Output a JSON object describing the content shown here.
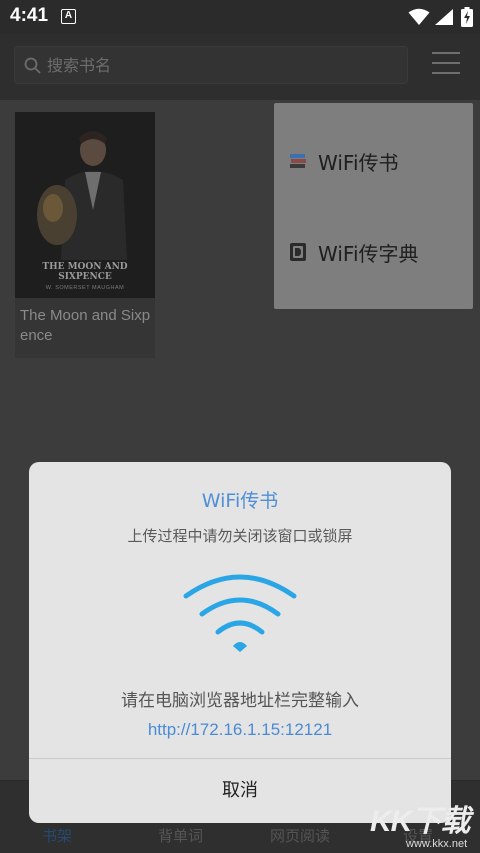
{
  "status_bar": {
    "time": "4:41",
    "notification_badge": "A",
    "icons": [
      "wifi-icon",
      "signal-icon",
      "battery-charging-icon"
    ]
  },
  "search": {
    "placeholder": "搜索书名",
    "icon": "search-icon"
  },
  "header": {
    "menu_icon": "menu-icon"
  },
  "bookshelf": {
    "books": [
      {
        "cover_title": "THE MOON AND SIXPENCE",
        "cover_author": "W. SOMERSET MAUGHAM",
        "title": "The Moon and Sixpence"
      }
    ]
  },
  "popup_menu": {
    "items": [
      {
        "label": "WiFi传书",
        "icon": "books-stack-icon"
      },
      {
        "label": "WiFi传字典",
        "icon": "dictionary-icon"
      }
    ]
  },
  "dialog": {
    "title": "WiFi传书",
    "subtitle": "上传过程中请勿关闭该窗口或锁屏",
    "wifi_icon": "wifi-icon",
    "instruction": "请在电脑浏览器地址栏完整输入",
    "url": "http://172.16.1.15:12121",
    "cancel_label": "取消"
  },
  "bottom_nav": {
    "items": [
      {
        "label": "书架",
        "active": true
      },
      {
        "label": "背单词",
        "active": false
      },
      {
        "label": "网页阅读",
        "active": false
      },
      {
        "label": "设置",
        "active": false
      }
    ]
  },
  "watermark": {
    "text": "KK下载",
    "sub": "www.kkx.net"
  },
  "colors": {
    "accent": "#4f8fd6",
    "wifi_blue": "#2aa6e6",
    "dim_background": "#3c3c3c",
    "dialog_background": "#e4e4e4"
  }
}
